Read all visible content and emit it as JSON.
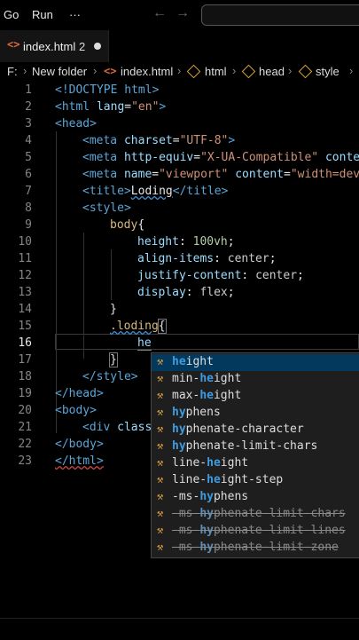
{
  "menubar": {
    "items": [
      "Go",
      "Run",
      "···"
    ],
    "back_icon": "arrow-left-icon",
    "forward_icon": "arrow-right-icon"
  },
  "tab": {
    "icon": "html-icon",
    "label": "index.html",
    "count": "2",
    "dirty": "dot-icon"
  },
  "breadcrumb": [
    "F:",
    "New folder",
    "index.html",
    "html",
    "head",
    "style"
  ],
  "gutter": [
    "1",
    "2",
    "3",
    "4",
    "5",
    "6",
    "7",
    "8",
    "9",
    "10",
    "11",
    "12",
    "13",
    "14",
    "15",
    "16",
    "17",
    "18",
    "19",
    "20",
    "21",
    "22",
    "23"
  ],
  "code": {
    "l1": "<!DOCTYPE html>",
    "l2a": "<html ",
    "l2b": "lang",
    "l2c": "=",
    "l2d": "\"en\"",
    "l2e": ">",
    "l3": "<head>",
    "l4a": "<meta ",
    "l4b": "charset",
    "l4c": "=",
    "l4d": "\"UTF-8\"",
    "l4e": ">",
    "l5a": "<meta ",
    "l5b": "http-equiv",
    "l5c": "=",
    "l5d": "\"X-UA-Compatible\"",
    "l5e": " ",
    "l5f": "conten",
    "l6a": "<meta ",
    "l6b": "name",
    "l6c": "=",
    "l6d": "\"viewport\"",
    "l6e": " ",
    "l6f": "content",
    "l6g": "=",
    "l6h": "\"width=devi",
    "l7a": "<title>",
    "l7b": "Loding",
    "l7c": "</title>",
    "l8": "<style>",
    "l9a": "body",
    "l9b": "{",
    "l10a": "height",
    "l10b": ": ",
    "l10c": "100vh",
    "l10d": ";",
    "l11a": "align-items",
    "l11b": ": ",
    "l11c": "center",
    "l11d": ";",
    "l12a": "justify-content",
    "l12b": ": ",
    "l12c": "center",
    "l12d": ";",
    "l13a": "display",
    "l13b": ": ",
    "l13c": "flex",
    "l13d": ";",
    "l14": "}",
    "l15a": ".loding",
    "l15b": "{",
    "l16": "he",
    "l17": "}",
    "l18": "</style>",
    "l19": "</head>",
    "l20": "<body>",
    "l21a": "<div ",
    "l21b": "class",
    "l22": "</body>",
    "l23": "</html>"
  },
  "suggestions": [
    {
      "pre": "",
      "hl": "he",
      "post": "ight",
      "deprecated": false
    },
    {
      "pre": "min-",
      "hl": "he",
      "post": "ight",
      "deprecated": false
    },
    {
      "pre": "max-",
      "hl": "he",
      "post": "ight",
      "deprecated": false
    },
    {
      "pre": "",
      "hl": "hy",
      "post": "phens",
      "deprecated": false
    },
    {
      "pre": "",
      "hl": "hy",
      "post": "phenate-character",
      "deprecated": false
    },
    {
      "pre": "",
      "hl": "hy",
      "post": "phenate-limit-chars",
      "deprecated": false
    },
    {
      "pre": "line-",
      "hl": "he",
      "post": "ight",
      "deprecated": false
    },
    {
      "pre": "line-",
      "hl": "he",
      "post": "ight-step",
      "deprecated": false
    },
    {
      "pre": "-ms-",
      "hl": "hy",
      "post": "phens",
      "deprecated": false
    },
    {
      "pre": "-ms-",
      "hl": "hy",
      "post": "phenate-limit-chars",
      "deprecated": true
    },
    {
      "pre": "-ms-",
      "hl": "hy",
      "post": "phenate-limit-lines",
      "deprecated": true
    },
    {
      "pre": "-ms-",
      "hl": "hy",
      "post": "phenate-limit-zone",
      "deprecated": true
    }
  ],
  "colors": {
    "tag": "#5aa6d8",
    "attr": "#9cdcfe",
    "string": "#ce9178",
    "selector": "#d7ba7d",
    "number": "#b5cea8",
    "suggest_bg": "#1e1e1e",
    "selected_bg": "#04395e"
  }
}
